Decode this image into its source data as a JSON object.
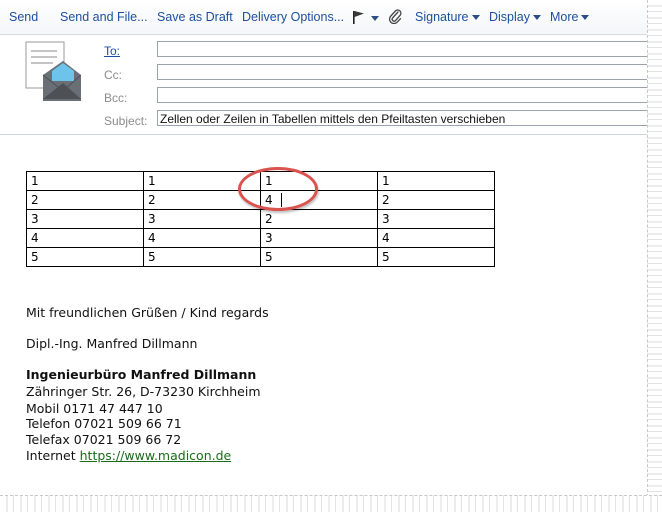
{
  "toolbar": {
    "send": "Send",
    "send_and_file": "Send and File...",
    "save_as_draft": "Save as Draft",
    "delivery_options": "Delivery Options...",
    "signature": "Signature",
    "display": "Display",
    "more": "More"
  },
  "header": {
    "to_label": "To:",
    "cc_label": "Cc:",
    "bcc_label": "Bcc:",
    "subject_label": "Subject:",
    "to_value": "",
    "cc_value": "",
    "bcc_value": "",
    "subject_value": "Zellen oder Zeilen in Tabellen mittels den Pfeiltasten verschieben"
  },
  "table": {
    "rows": [
      [
        "1",
        "1",
        "1",
        "1"
      ],
      [
        "2",
        "2",
        "4",
        "2"
      ],
      [
        "3",
        "3",
        "2",
        "3"
      ],
      [
        "4",
        "4",
        "3",
        "4"
      ],
      [
        "5",
        "5",
        "5",
        "5"
      ]
    ]
  },
  "signature": {
    "greeting": "Mit freundlichen Grüßen / Kind regards",
    "name": "Dipl.-Ing. Manfred Dillmann",
    "company": "Ingenieurbüro Manfred Dillmann",
    "address": "Zähringer Str. 26, D-73230 Kirchheim",
    "mobile": "Mobil 0171 47 447 10",
    "phone": "Telefon 07021 509 66 71",
    "fax": "Telefax 07021 509 66 72",
    "internet_label": "Internet",
    "internet_url": "https://www.madicon.de"
  },
  "colors": {
    "toolbar_text": "#1c4f9c",
    "highlight_circle": "#d9534f",
    "link": "#1a6b1a"
  }
}
